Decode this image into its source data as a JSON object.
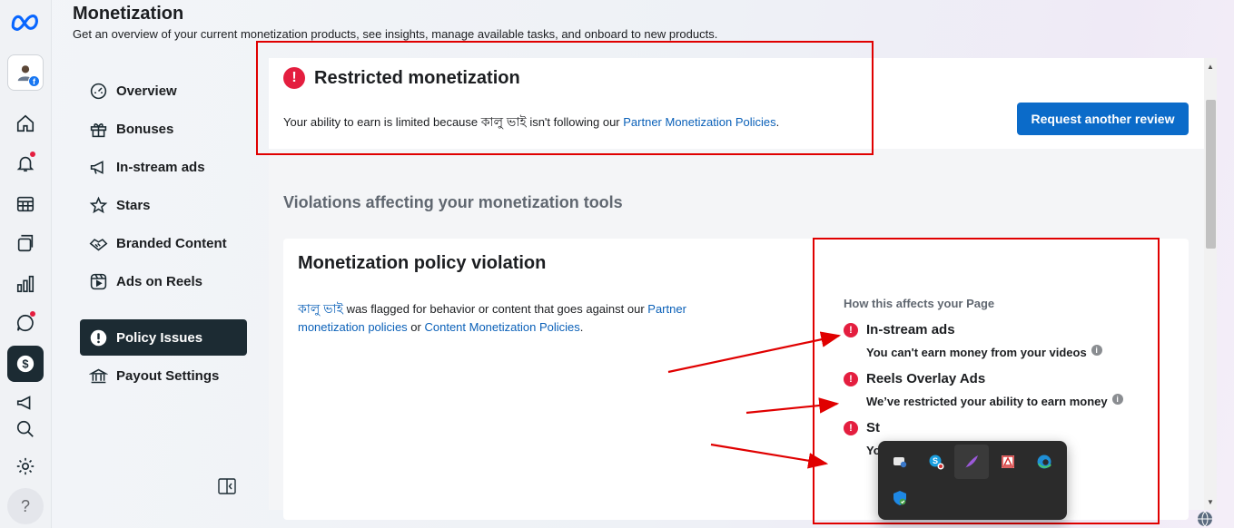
{
  "page": {
    "title": "Monetization",
    "subtitle": "Get an overview of your current monetization products, see insights, manage available tasks, and onboard to new products."
  },
  "rail": {
    "avatar_badge": "f",
    "help_label": "?",
    "items": [
      "home",
      "notifications",
      "content",
      "posts",
      "insights",
      "inbox",
      "monetization",
      "ads",
      "search",
      "settings"
    ]
  },
  "nav": {
    "items": [
      {
        "label": "Overview",
        "icon": "gauge-icon"
      },
      {
        "label": "Bonuses",
        "icon": "gift-icon"
      },
      {
        "label": "In-stream ads",
        "icon": "megaphone-icon"
      },
      {
        "label": "Stars",
        "icon": "star-icon"
      },
      {
        "label": "Branded Content",
        "icon": "handshake-icon"
      },
      {
        "label": "Ads on Reels",
        "icon": "reels-icon"
      },
      {
        "label": "Policy Issues",
        "icon": "alert-icon",
        "active": true
      },
      {
        "label": "Payout Settings",
        "icon": "bank-icon"
      }
    ]
  },
  "restricted": {
    "badge": "!",
    "title": "Restricted monetization",
    "text_before": "Your ability to earn is limited because ",
    "page_name": "কালু ভাই",
    "text_after": " isn't following our ",
    "policy_link": "Partner Monetization Policies",
    "text_end": ".",
    "button_label": "Request another review"
  },
  "violations": {
    "heading": "Violations affecting your monetization tools",
    "card": {
      "title": "Monetization policy violation",
      "page_name": "কালু ভাই",
      "text_1": " was flagged for behavior or content that goes against our ",
      "link_1": "Partner monetization policies",
      "text_2": " or ",
      "link_2": "Content Monetization Policies",
      "text_3": ".",
      "affects_title": "How this affects your Page",
      "impacts": [
        {
          "title": "In-stream ads",
          "description": "You can't earn money from your videos"
        },
        {
          "title": "Reels Overlay Ads",
          "description": "We’ve restricted your ability to earn money"
        },
        {
          "title": "St",
          "description": "Yo"
        }
      ]
    }
  },
  "tray": {
    "icons": [
      "feedback-hub-icon",
      "skype-icon",
      "feather-icon",
      "pdf-icon",
      "edge-icon",
      "shield-icon"
    ]
  },
  "colors": {
    "accent": "#0b6bc9",
    "error": "#e41e3f",
    "annotation": "#e00000",
    "nav_active": "#1c2b33"
  }
}
